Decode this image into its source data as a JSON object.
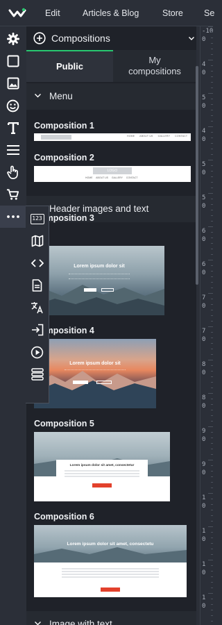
{
  "topbar": {
    "logo_icon": "wix-logo-icon",
    "nav": [
      {
        "label": "Edit"
      },
      {
        "label": "Articles & Blog"
      },
      {
        "label": "Store"
      },
      {
        "label": "Se"
      }
    ]
  },
  "sidebar": {
    "items": [
      {
        "icon": "gear-icon"
      },
      {
        "icon": "square-icon"
      },
      {
        "icon": "image-icon"
      },
      {
        "icon": "smiley-icon"
      },
      {
        "icon": "text-icon"
      },
      {
        "icon": "menu-icon"
      },
      {
        "icon": "hand-pointer-icon"
      },
      {
        "icon": "cart-icon"
      },
      {
        "icon": "more-icon"
      }
    ]
  },
  "flyout": {
    "items": [
      {
        "icon": "counter-123-icon",
        "text": "123"
      },
      {
        "icon": "map-icon"
      },
      {
        "icon": "code-icon"
      },
      {
        "icon": "document-icon"
      },
      {
        "icon": "translate-icon"
      },
      {
        "icon": "login-icon"
      },
      {
        "icon": "play-icon"
      },
      {
        "icon": "stack-icon"
      }
    ]
  },
  "panel": {
    "title": "Compositions",
    "add_icon": "plus-circle-icon",
    "dropdown_icon": "chevron-down-icon",
    "tabs": [
      {
        "label": "Public",
        "active": true
      },
      {
        "label": "My compositions",
        "active": false
      }
    ],
    "sections": [
      {
        "label": "Menu"
      },
      {
        "label": "Header images and text"
      },
      {
        "label": "Image with text"
      }
    ],
    "compositions": [
      {
        "label": "Composition 1",
        "menu": [
          "HOME",
          "ABOUT US",
          "GALLERY",
          "CONTACT"
        ]
      },
      {
        "label": "Composition 2",
        "logo": "LOGO",
        "menu": [
          "HOME",
          "ABOUT US",
          "GALLERY",
          "CONTACT"
        ]
      },
      {
        "label": "Composition 3",
        "heading": "Lorem ipsum dolor sit"
      },
      {
        "label": "Composition 4",
        "heading": "Lorem ipsum dolor sit"
      },
      {
        "label": "Composition 5",
        "heading": "Lorem ipsum dolor sit amet, consectetur"
      },
      {
        "label": "Composition 6",
        "heading": "Lorem ipsum dolor sit amet, consectetu"
      }
    ]
  },
  "ruler": {
    "labels": [
      "-10",
      "4",
      "5",
      "4",
      "5",
      "5",
      "6",
      "6",
      "7",
      "7",
      "8",
      "8",
      "9",
      "9",
      "1",
      "1",
      "1",
      "1"
    ]
  },
  "colors": {
    "accent": "#28c76f",
    "panel_bg": "#1f2229",
    "chrome_bg": "#2b2f38",
    "button_red": "#e2412c"
  }
}
